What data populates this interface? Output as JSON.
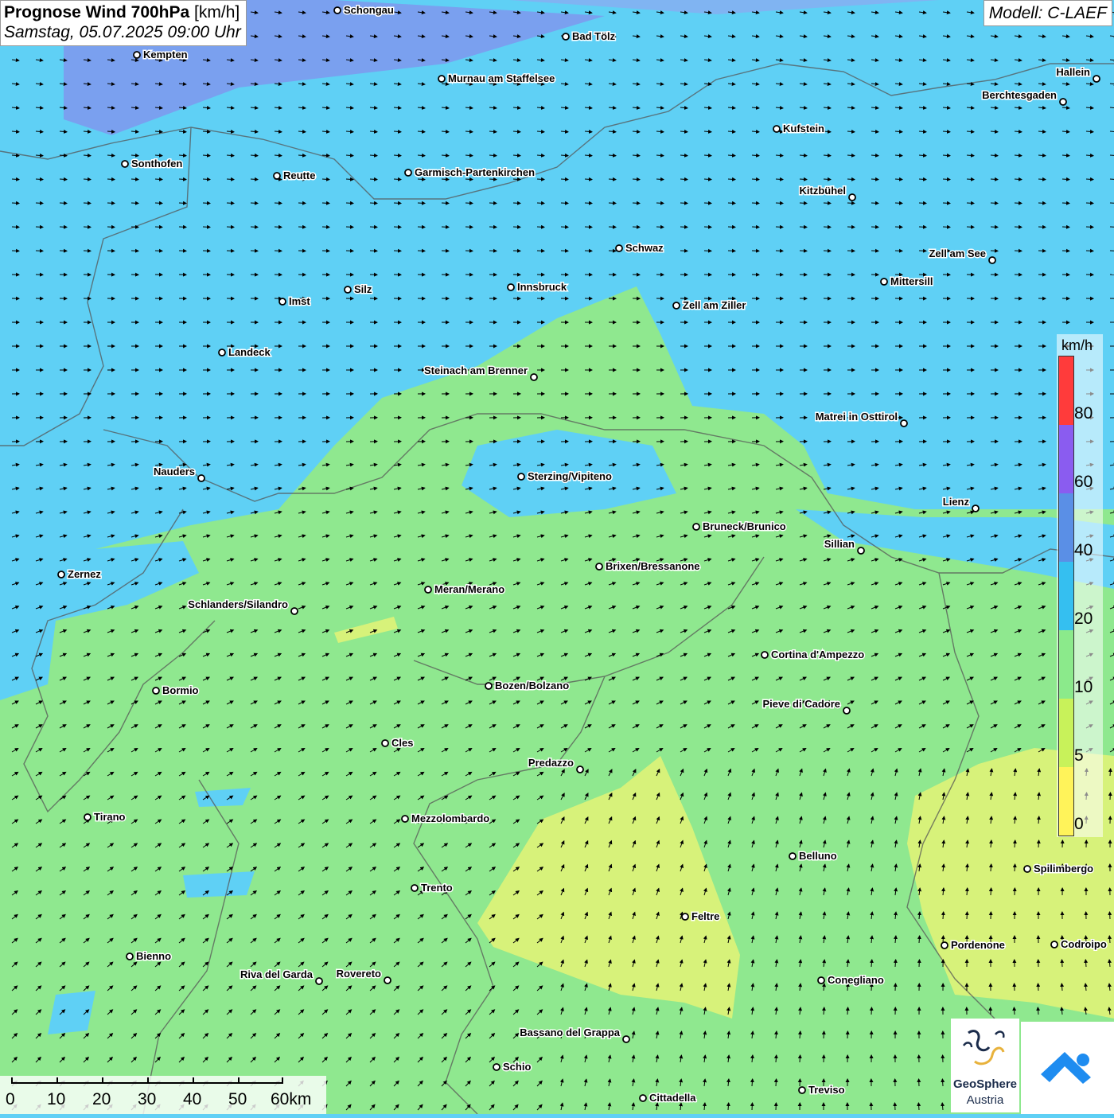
{
  "title": {
    "main": "Prognose Wind 700hPa",
    "unit": "[km/h]",
    "datetime": "Samstag, 05.07.2025 09:00 Uhr"
  },
  "model": "Modell: C-LAEF",
  "legend": {
    "unit": "km/h",
    "ticks": [
      "80",
      "60",
      "40",
      "20",
      "10",
      "5",
      "0"
    ],
    "colors": [
      "#ff3b3b",
      "#b9a6f2",
      "#8a5cf0",
      "#5a8fe6",
      "#35bff0",
      "#8bea8b",
      "#c8f25a",
      "#fff35a"
    ]
  },
  "scale": {
    "labels": [
      "0",
      "10",
      "20",
      "30",
      "40",
      "50",
      "60km"
    ]
  },
  "logos": {
    "geosphere_line1": "GeoSphere",
    "geosphere_line2": "Austria"
  },
  "cities": [
    {
      "name": "Schongau"
    },
    {
      "name": "Bad Tölz"
    },
    {
      "name": "Kempten"
    },
    {
      "name": "Murnau am Staffelsee"
    },
    {
      "name": "Hallein"
    },
    {
      "name": "Berchtesgaden"
    },
    {
      "name": "Kufstein"
    },
    {
      "name": "Sonthofen"
    },
    {
      "name": "Reutte"
    },
    {
      "name": "Garmisch-Partenkirchen"
    },
    {
      "name": "Kitzbühel"
    },
    {
      "name": "Schwaz"
    },
    {
      "name": "Zell am See"
    },
    {
      "name": "Mittersill"
    },
    {
      "name": "Innsbruck"
    },
    {
      "name": "Silz"
    },
    {
      "name": "Imst"
    },
    {
      "name": "Zell am Ziller"
    },
    {
      "name": "Landeck"
    },
    {
      "name": "Steinach am Brenner"
    },
    {
      "name": "Matrei in Osttirol"
    },
    {
      "name": "Nauders"
    },
    {
      "name": "Sterzing/Vipiteno"
    },
    {
      "name": "Lienz"
    },
    {
      "name": "Bruneck/Brunico"
    },
    {
      "name": "Sillian"
    },
    {
      "name": "Brixen/Bressanone"
    },
    {
      "name": "Zernez"
    },
    {
      "name": "Meran/Merano"
    },
    {
      "name": "Schlanders/Silandro"
    },
    {
      "name": "Cortina d'Ampezzo"
    },
    {
      "name": "Bozen/Bolzano"
    },
    {
      "name": "Bormio"
    },
    {
      "name": "Pieve di Cadore"
    },
    {
      "name": "Cles"
    },
    {
      "name": "Predazzo"
    },
    {
      "name": "Tirano"
    },
    {
      "name": "Mezzolombardo"
    },
    {
      "name": "Belluno"
    },
    {
      "name": "Spilimbergo"
    },
    {
      "name": "Trento"
    },
    {
      "name": "Feltre"
    },
    {
      "name": "Pordenone"
    },
    {
      "name": "Codroipo"
    },
    {
      "name": "Bienno"
    },
    {
      "name": "Riva del Garda"
    },
    {
      "name": "Rovereto"
    },
    {
      "name": "Conegliano"
    },
    {
      "name": "Bassano del Grappa"
    },
    {
      "name": "Schio"
    },
    {
      "name": "Treviso"
    },
    {
      "name": "Cittadella"
    }
  ]
}
